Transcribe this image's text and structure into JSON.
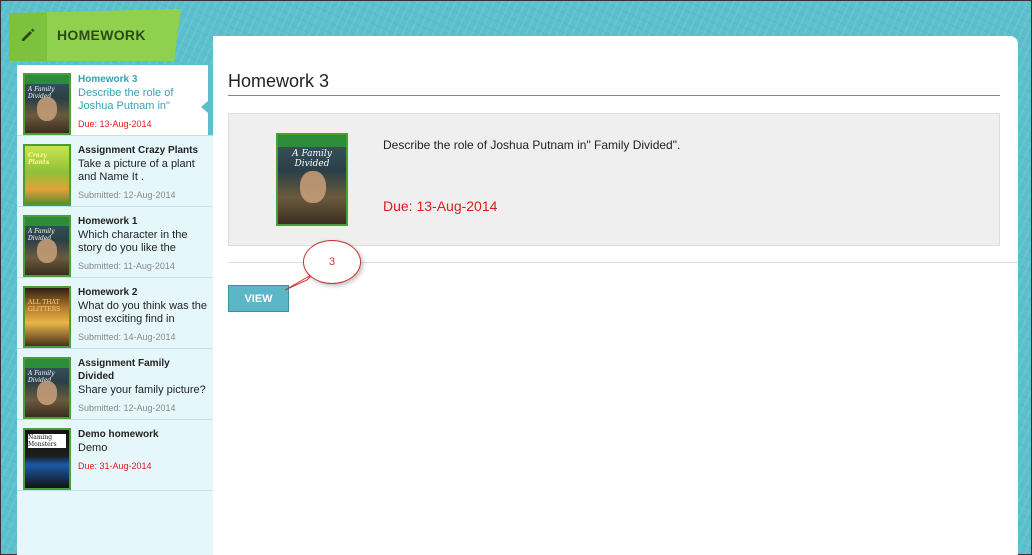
{
  "header": {
    "title": "HOMEWORK",
    "icon": "pencil-icon"
  },
  "sidebar": {
    "items": [
      {
        "title": "Homework 3",
        "desc": "Describe the role of Joshua Putnam in\"",
        "meta": "Due: 13-Aug-2014",
        "cover_label": "A Family Divided"
      },
      {
        "title": "Assignment Crazy Plants",
        "desc": "Take a picture of a plant and Name It .",
        "meta": "Submitted: 12-Aug-2014",
        "cover_label": "Crazy Plants"
      },
      {
        "title": "Homework 1",
        "desc": "Which character in the story do you like the",
        "meta": "Submitted: 11-Aug-2014",
        "cover_label": "A Family Divided"
      },
      {
        "title": "Homework 2",
        "desc": "What do you think was the most exciting find in",
        "meta": "Submitted: 14-Aug-2014",
        "cover_label": "ALL THAT GLITTERS"
      },
      {
        "title": "Assignment Family Divided",
        "desc": "Share your family picture?",
        "meta": "Submitted: 12-Aug-2014",
        "cover_label": "A Family Divided"
      },
      {
        "title": "Demo homework",
        "desc": "Demo",
        "meta": "Due: 31-Aug-2014",
        "cover_label": "Naming Monsters"
      }
    ]
  },
  "main": {
    "title": "Homework 3",
    "description": "Describe the role of Joshua Putnam in\" Family Divided\".",
    "due": "Due: 13-Aug-2014",
    "cover_label": "A Family Divided",
    "view_label": "VIEW",
    "callout_number": "3"
  },
  "colors": {
    "accent": "#5bbfcc",
    "header_green": "#8fd14f",
    "due_red": "#e01b1b"
  }
}
